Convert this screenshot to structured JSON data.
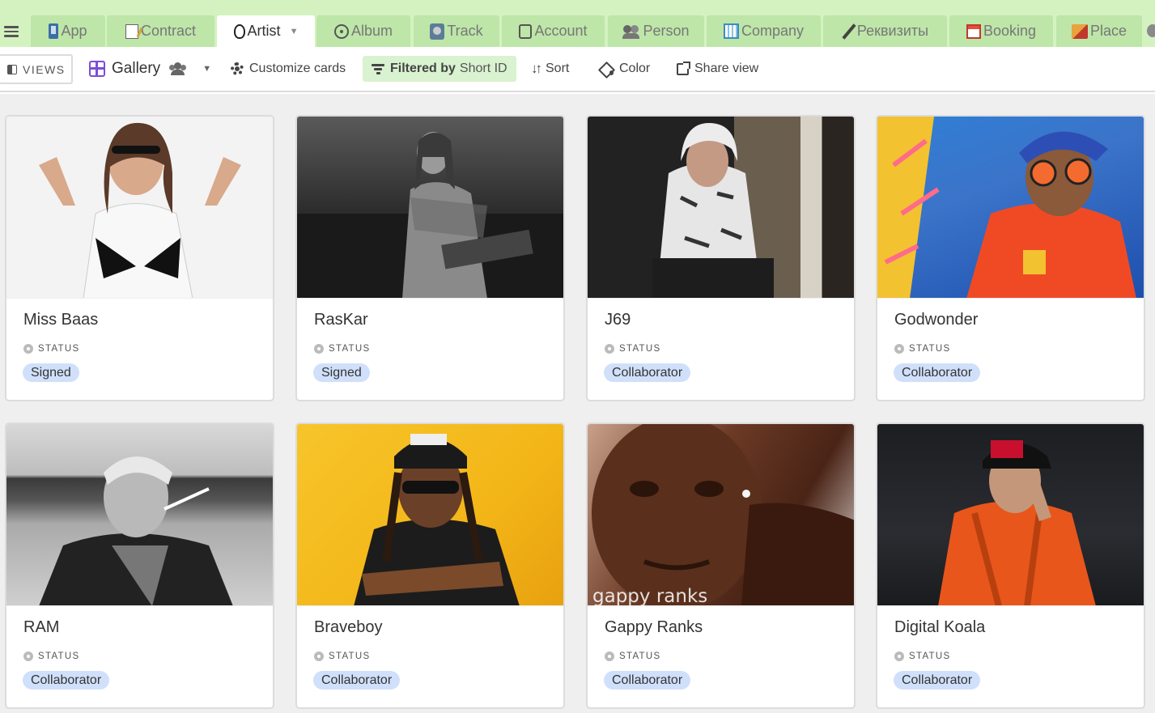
{
  "tabs": [
    {
      "label": "App",
      "icon": "app-icon",
      "active": false
    },
    {
      "label": "Contract",
      "icon": "contract-icon",
      "active": false
    },
    {
      "label": "Artist",
      "icon": "microphone-icon",
      "active": true
    },
    {
      "label": "Album",
      "icon": "album-icon",
      "active": false
    },
    {
      "label": "Track",
      "icon": "track-icon",
      "active": false
    },
    {
      "label": "Account",
      "icon": "account-icon",
      "active": false
    },
    {
      "label": "Person",
      "icon": "person-icon",
      "active": false
    },
    {
      "label": "Company",
      "icon": "company-icon",
      "active": false
    },
    {
      "label": "Реквизиты",
      "icon": "pen-icon",
      "active": false
    },
    {
      "label": "Booking",
      "icon": "booking-icon",
      "active": false
    },
    {
      "label": "Place",
      "icon": "place-icon",
      "active": false
    }
  ],
  "toolbar": {
    "views_label": "VIEWS",
    "view_name": "Gallery",
    "customize_label": "Customize cards",
    "filter_label": "Filtered by",
    "filter_field": "Short ID",
    "sort_label": "Sort",
    "color_label": "Color",
    "share_label": "Share view"
  },
  "colors": {
    "tab_bar": "#d4f2c0",
    "tab_inactive": "#bde6a8",
    "filter_bg": "#d9f2d0",
    "badge_bg": "#d0e0fb",
    "gallery_icon": "#7c4ddb"
  },
  "status_field_label": "STATUS",
  "cards": [
    {
      "name": "Miss Baas",
      "status": "Signed"
    },
    {
      "name": "RasKar",
      "status": "Signed"
    },
    {
      "name": "J69",
      "status": "Collaborator"
    },
    {
      "name": "Godwonder",
      "status": "Collaborator"
    },
    {
      "name": "RAM",
      "status": "Collaborator"
    },
    {
      "name": "Braveboy",
      "status": "Collaborator"
    },
    {
      "name": "Gappy Ranks",
      "status": "Collaborator",
      "photo_watermark": "gappy ranks"
    },
    {
      "name": "Digital Koala",
      "status": "Collaborator"
    }
  ]
}
